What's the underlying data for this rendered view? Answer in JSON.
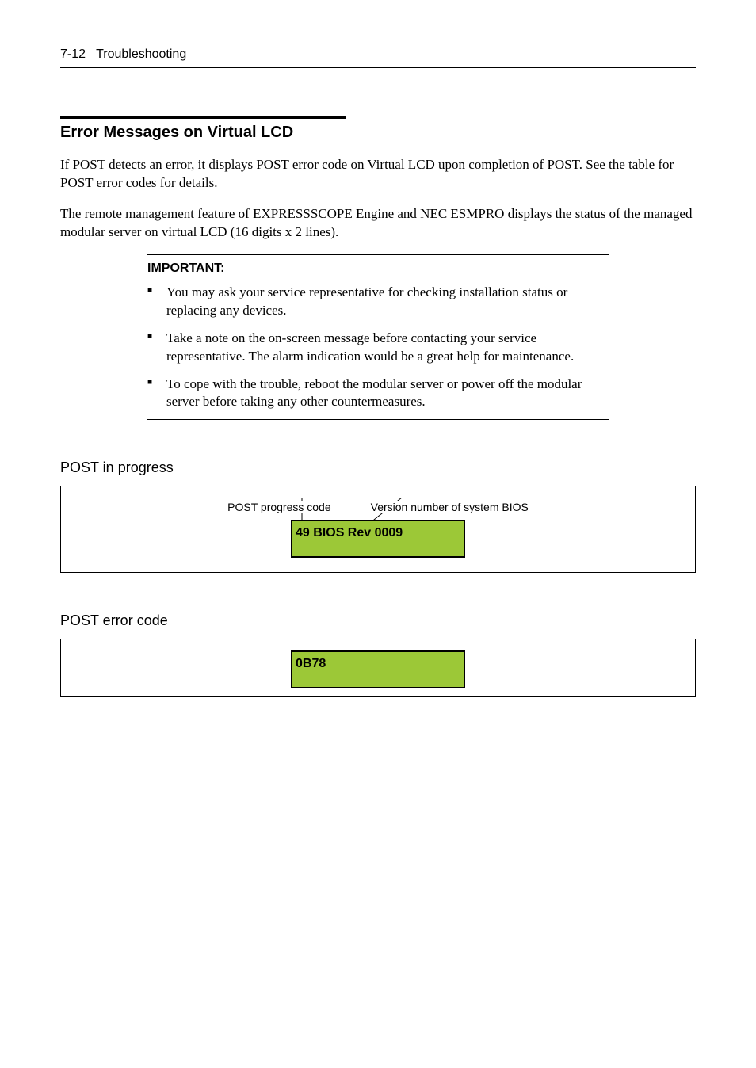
{
  "header": {
    "page_number": "7-12",
    "section": "Troubleshooting"
  },
  "section_title": "Error Messages on Virtual LCD",
  "paragraphs": {
    "p1": "If POST detects an error, it displays POST error code on Virtual LCD upon completion of POST. See the table for POST error codes for details.",
    "p2": "The remote management feature of EXPRESSSCOPE Engine and NEC ESMPRO displays the status of the managed modular server on virtual LCD (16 digits x 2 lines)."
  },
  "important": {
    "title": "IMPORTANT:",
    "items": [
      "You may ask your service representative for checking installation status or replacing any devices.",
      "Take a note on the on-screen message before contacting your service representative. The alarm indication would be a great help for maintenance.",
      "To cope with the trouble, reboot the modular server or power off the modular server before taking any other countermeasures."
    ]
  },
  "post_progress": {
    "heading": "POST in progress",
    "label_left": "POST progress code",
    "label_right": "Version number of system BIOS",
    "lcd_text": "49 BIOS Rev 0009"
  },
  "post_error": {
    "heading": "POST error code",
    "lcd_text": "0B78"
  }
}
